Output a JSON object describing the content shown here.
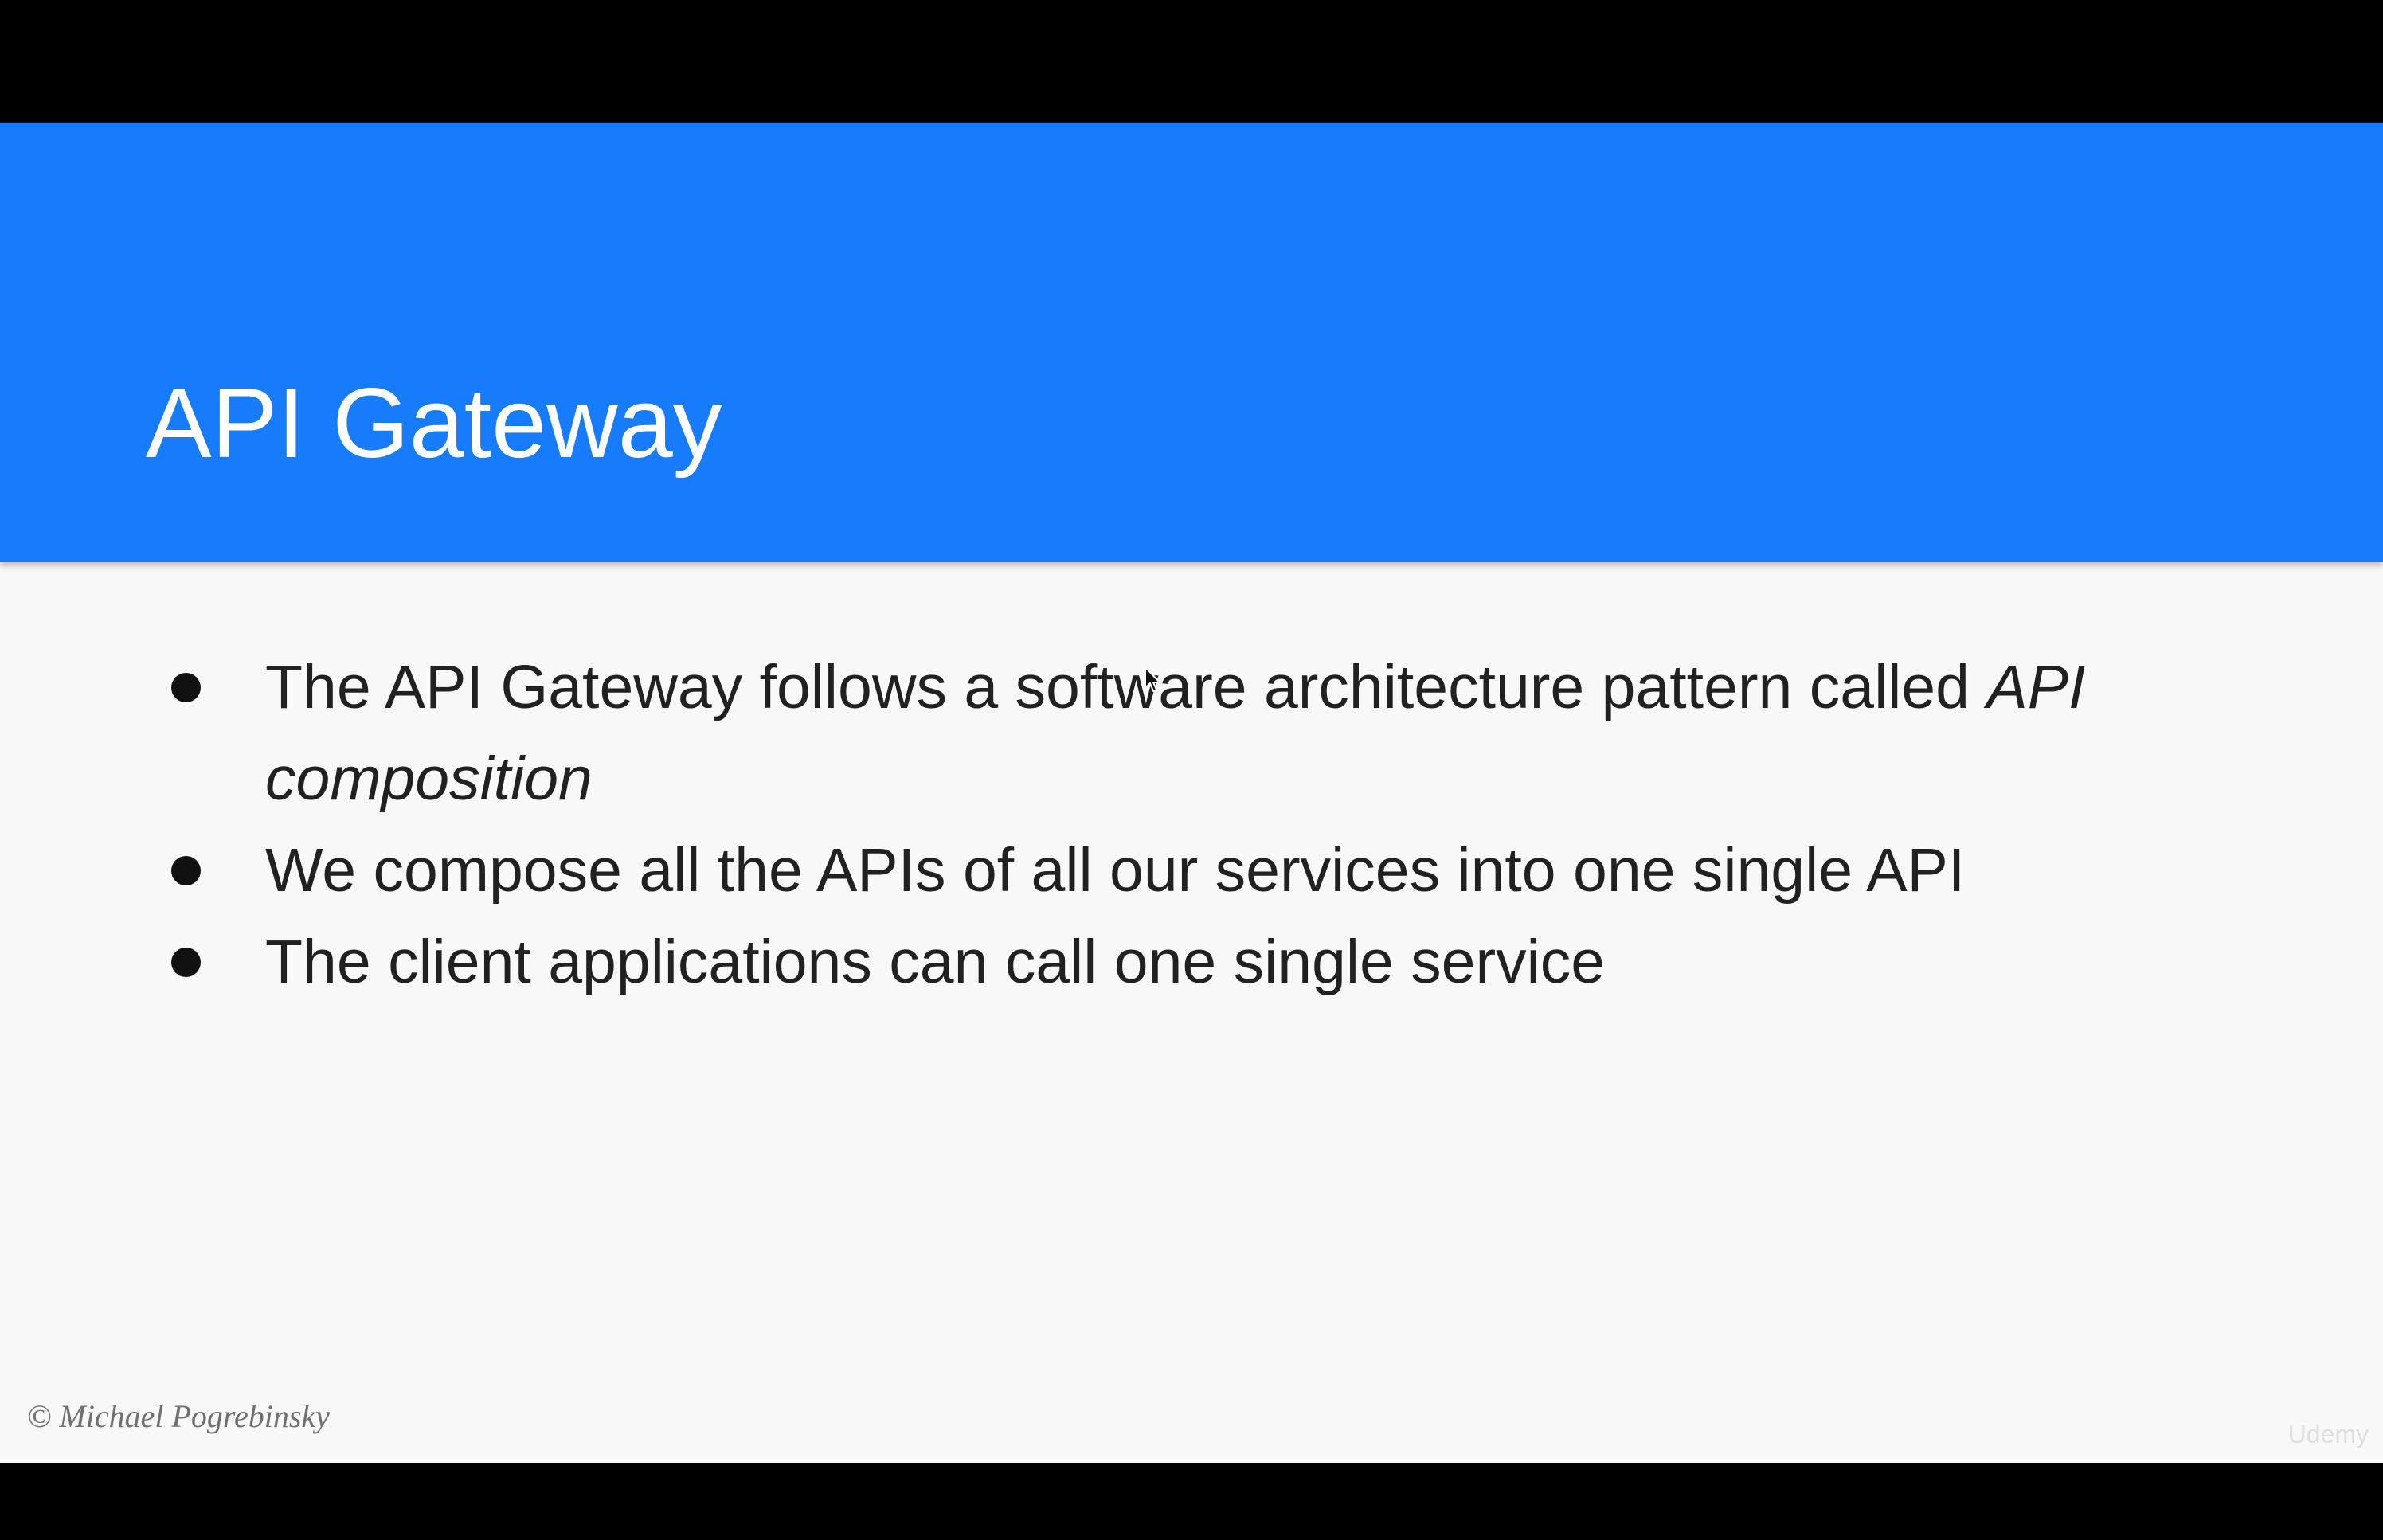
{
  "slide": {
    "title": "API Gateway",
    "bullets": [
      {
        "text": "The API Gateway follows a software architecture pattern called ",
        "emphasis": "API composition"
      },
      {
        "text": "We compose all the APIs of all our services into one single API",
        "emphasis": ""
      },
      {
        "text": "The client applications can call one single service",
        "emphasis": ""
      }
    ],
    "copyright": "© Michael Pogrebinsky",
    "watermark": "Udemy"
  },
  "colors": {
    "header": "#167cfb",
    "background": "#f8f8f8",
    "text": "#212121",
    "letterbox": "#000000"
  },
  "icons": {
    "cursor": "mouse-pointer-icon",
    "bullet": "bullet-dot-icon"
  }
}
